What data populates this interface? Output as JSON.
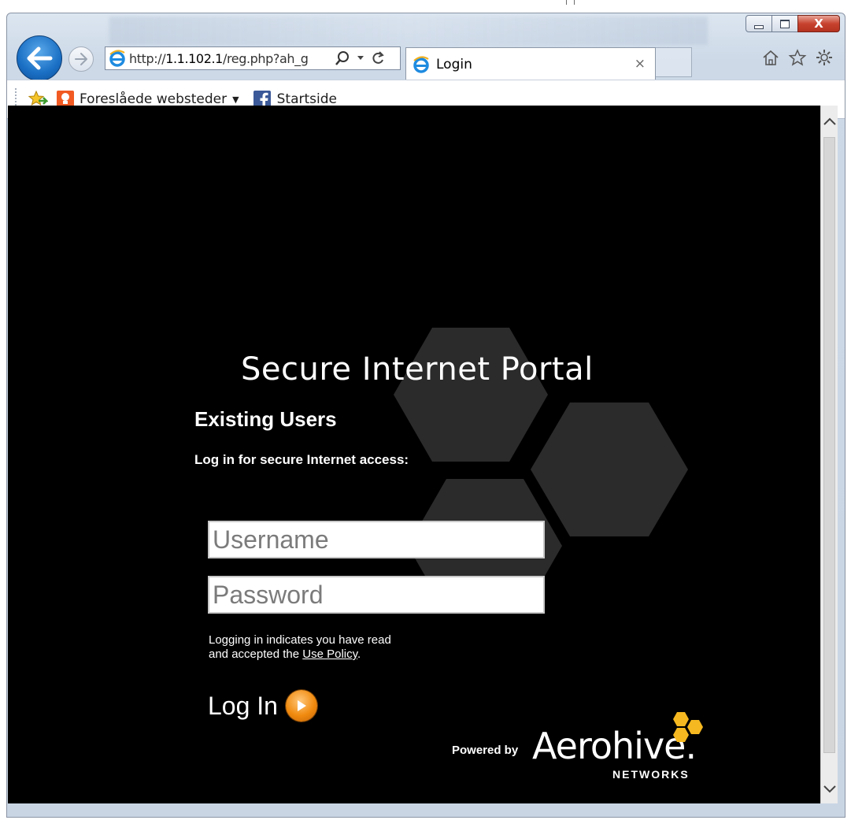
{
  "browser": {
    "address_url_prefix": "http://",
    "address_url_host": "1.1.102.1",
    "address_url_rest": "/reg.php?ah_g",
    "tab_title": "Login",
    "tab_close": "×",
    "caption_close": "X"
  },
  "favorites": {
    "items": [
      {
        "label": "Foreslåede websteder",
        "icon": "suggested-sites-icon",
        "has_dropdown": true
      },
      {
        "label": "Startside",
        "icon": "facebook-icon",
        "has_dropdown": false
      }
    ]
  },
  "portal": {
    "title": "Secure Internet Portal",
    "section_heading": "Existing Users",
    "subheading": "Log in for secure Internet access:",
    "username_placeholder": "Username",
    "password_placeholder": "Password",
    "policy_line1": "Logging in indicates you have read",
    "policy_line2_prefix": "and accepted the ",
    "policy_link": "Use Policy",
    "policy_suffix": ".",
    "login_label": "Log In"
  },
  "branding": {
    "powered_by": "Powered by",
    "brand_name": "Aerohive",
    "brand_sub": "NETWORKS",
    "brand_dot": "."
  },
  "colors": {
    "page_background": "#000000",
    "accent_orange": "#f08a0e",
    "logo_yellow": "#f5b820",
    "hex_gray": "#2b2b2b",
    "ie_blue": "#1a6fc4"
  }
}
